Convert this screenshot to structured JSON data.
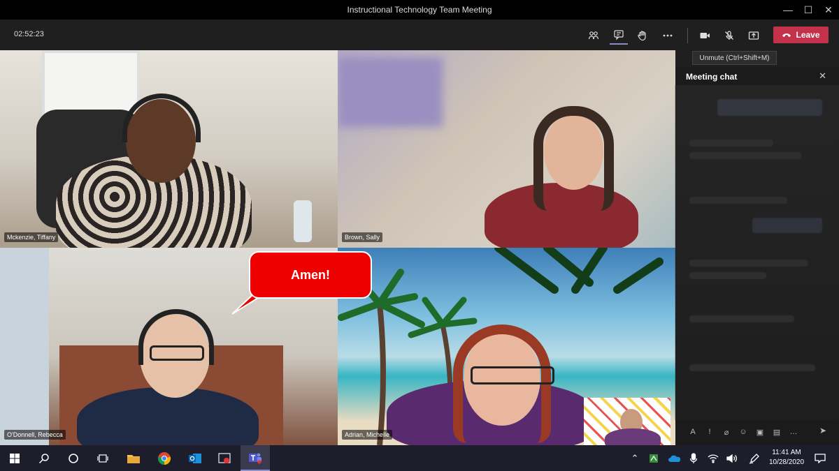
{
  "window": {
    "title": "Instructional Technology Team Meeting",
    "minimize": "—",
    "maximize": "☐",
    "close": "✕"
  },
  "toolbar": {
    "timer": "02:52:23",
    "leave_label": "Leave",
    "tooltip": "Unmute (Ctrl+Shift+M)",
    "icons": [
      "participants-icon",
      "chat-icon",
      "raise-hand-icon",
      "more-icon",
      "camera-icon",
      "mic-muted-icon",
      "share-icon"
    ]
  },
  "participants": [
    {
      "name": "Mckenzie, Tiffany"
    },
    {
      "name": "Brown, Sally"
    },
    {
      "name": "O'Donnell, Rebecca"
    },
    {
      "name": "Adrian, Michelle"
    }
  ],
  "bubble": {
    "text": "Amen!"
  },
  "chat": {
    "title": "Meeting chat",
    "close": "✕"
  },
  "taskbar": {
    "time": "11:41 AM",
    "date": "10/28/2020"
  },
  "colors": {
    "leave": "#c4314b",
    "accent": "#8b8cc7",
    "bubble": "#ee0000"
  }
}
